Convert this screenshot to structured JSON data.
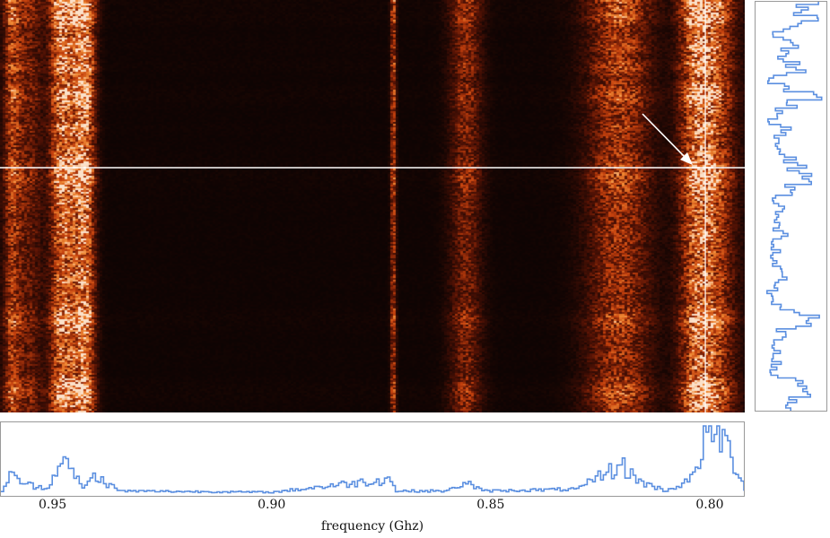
{
  "chart_data": {
    "type": "heatmap",
    "xlabel": "frequency (Ghz)",
    "xlim": [
      0.962,
      0.792
    ],
    "x_ticks": [
      {
        "value": 0.95,
        "label": "0.95"
      },
      {
        "value": 0.9,
        "label": "0.90"
      },
      {
        "value": 0.85,
        "label": "0.85"
      },
      {
        "value": 0.8,
        "label": "0.80"
      }
    ],
    "colormap": [
      "#0a0303",
      "#5a1405",
      "#c4400d",
      "#f08a35",
      "#ffffff"
    ],
    "bands_ghz": [
      {
        "center": 0.9595,
        "width": 0.002,
        "intensity": 0.75
      },
      {
        "center": 0.9555,
        "width": 0.003,
        "intensity": 0.45
      },
      {
        "center": 0.9485,
        "width": 0.0025,
        "intensity": 1.0
      },
      {
        "center": 0.9445,
        "width": 0.003,
        "intensity": 0.85
      },
      {
        "center": 0.9425,
        "width": 0.002,
        "intensity": 0.7
      },
      {
        "center": 0.8725,
        "width": 0.0006,
        "intensity": 0.8
      },
      {
        "center": 0.856,
        "width": 0.0035,
        "intensity": 0.55
      },
      {
        "center": 0.821,
        "width": 0.007,
        "intensity": 0.75
      },
      {
        "center": 0.804,
        "width": 0.0035,
        "intensity": 0.6
      },
      {
        "center": 0.8,
        "width": 0.005,
        "intensity": 1.0
      }
    ],
    "marker_frequency": 0.801,
    "bottom_spectrum": {
      "color": "#5b8fe0",
      "frequency": [
        0.962,
        0.96,
        0.956,
        0.952,
        0.949,
        0.948,
        0.947,
        0.943,
        0.941,
        0.935,
        0.9,
        0.873,
        0.872,
        0.86,
        0.856,
        0.852,
        0.83,
        0.824,
        0.82,
        0.816,
        0.81,
        0.804,
        0.801,
        0.798,
        0.795,
        0.792
      ],
      "power": [
        0.05,
        0.3,
        0.15,
        0.1,
        0.4,
        0.95,
        0.4,
        0.1,
        0.3,
        0.05,
        0.03,
        0.25,
        0.05,
        0.05,
        0.2,
        0.05,
        0.08,
        0.35,
        0.45,
        0.2,
        0.05,
        0.25,
        0.95,
        1.0,
        0.6,
        0.1
      ]
    },
    "side_profile": {
      "color": "#5b8fe0",
      "power_by_row": [
        0.85,
        0.8,
        0.75,
        0.9,
        0.7,
        0.3,
        0.35,
        0.5,
        0.6,
        0.4,
        0.35,
        0.7,
        0.65,
        0.3,
        0.25,
        0.6,
        0.7,
        0.8,
        0.55,
        0.35,
        0.3,
        0.25,
        0.6,
        0.4,
        0.3,
        0.25,
        0.35,
        0.45,
        0.5,
        0.7,
        0.75,
        0.9,
        0.6,
        0.55,
        0.4,
        0.35,
        0.45,
        0.3,
        0.25,
        0.3,
        0.35,
        0.4,
        0.3,
        0.25,
        0.3,
        0.2,
        0.25,
        0.3,
        0.35,
        0.4,
        0.3,
        0.2,
        0.25,
        0.3,
        0.5,
        0.75,
        0.8,
        0.55,
        0.4,
        0.3,
        0.25,
        0.35,
        0.4,
        0.3,
        0.25,
        0.2,
        0.5,
        0.7,
        0.85,
        0.8,
        0.6,
        0.45,
        0.35
      ]
    }
  }
}
